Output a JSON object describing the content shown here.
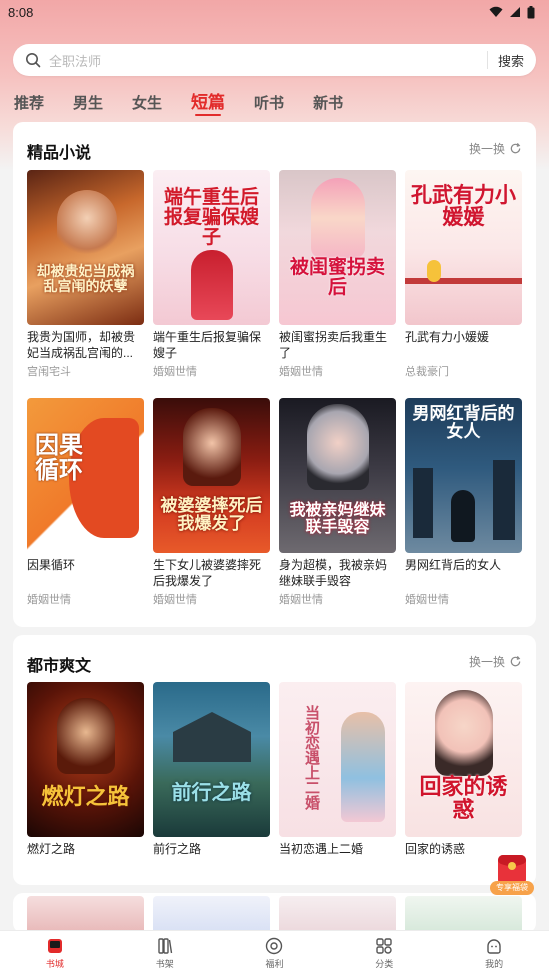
{
  "status_bar": {
    "time": "8:08"
  },
  "search": {
    "placeholder": "全职法师",
    "button": "搜索"
  },
  "tabs": [
    {
      "label": "推荐"
    },
    {
      "label": "男生"
    },
    {
      "label": "女生"
    },
    {
      "label": "短篇"
    },
    {
      "label": "听书"
    },
    {
      "label": "新书"
    }
  ],
  "section1": {
    "title": "精品小说",
    "refresh": "换一换",
    "books": [
      {
        "title": "我贵为国师，却被贵妃当成祸乱宫闱的...",
        "category": "宫闱宅斗",
        "cover_text": "却被贵妃当成祸乱宫闱的妖孽"
      },
      {
        "title": "端午重生后报复骗保嫂子",
        "category": "婚姻世情",
        "cover_text": "端午重生后报复骗保嫂子"
      },
      {
        "title": "被闺蜜拐卖后我重生了",
        "category": "婚姻世情",
        "cover_text": "被闺蜜拐卖后"
      },
      {
        "title": "孔武有力小媛媛",
        "category": "总裁豪门",
        "cover_text": "孔武有力小媛媛"
      },
      {
        "title": "因果循环",
        "category": "婚姻世情",
        "cover_text": "因果循环"
      },
      {
        "title": "生下女儿被婆婆摔死后我爆发了",
        "category": "婚姻世情",
        "cover_text": "被婆婆摔死后我爆发了"
      },
      {
        "title": "身为超模，我被亲妈继妹联手毁容",
        "category": "婚姻世情",
        "cover_text": "我被亲妈继妹联手毁容"
      },
      {
        "title": "男网红背后的女人",
        "category": "婚姻世情",
        "cover_text": "男网红背后的女人"
      }
    ]
  },
  "section2": {
    "title": "都市爽文",
    "refresh": "换一换",
    "books": [
      {
        "title": "燃灯之路",
        "cover_text": "燃灯之路"
      },
      {
        "title": "前行之路",
        "cover_text": "前行之路"
      },
      {
        "title": "当初恋遇上二婚",
        "cover_text": "当初恋遇上二婚"
      },
      {
        "title": "回家的诱惑",
        "cover_text": "回家的诱惑"
      }
    ]
  },
  "float_badge": "专享福袋",
  "bottom_nav": [
    {
      "label": "书城",
      "icon": "bookstore-icon"
    },
    {
      "label": "书架",
      "icon": "bookshelf-icon"
    },
    {
      "label": "福利",
      "icon": "welfare-icon"
    },
    {
      "label": "分类",
      "icon": "category-icon"
    },
    {
      "label": "我的",
      "icon": "profile-icon"
    }
  ],
  "colors": {
    "accent": "#e22b2b",
    "header_gradient_top": "#f2a7a7"
  }
}
